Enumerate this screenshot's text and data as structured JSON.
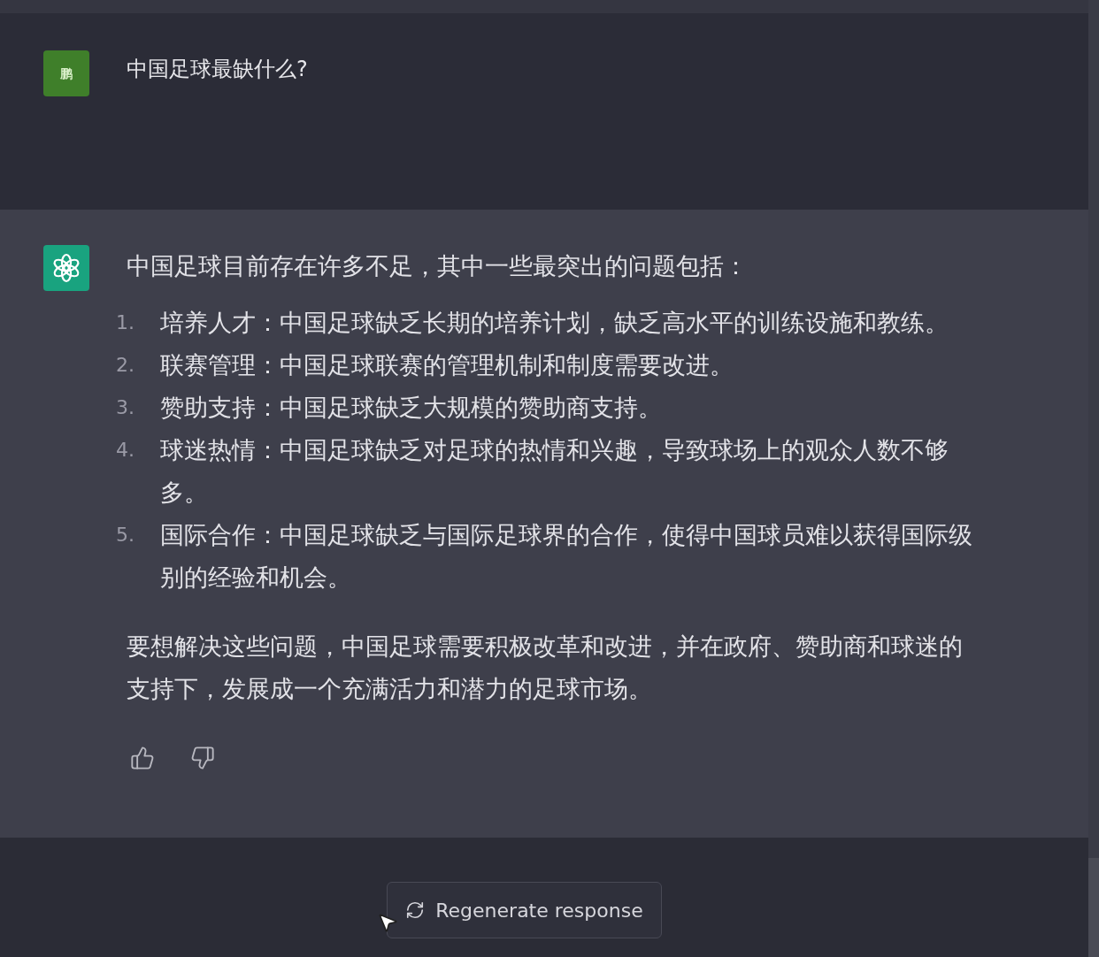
{
  "user_message": {
    "avatar": "鹏",
    "text": "中国足球最缺什么?"
  },
  "assistant_message": {
    "intro": "中国足球目前存在许多不足，其中一些最突出的问题包括：",
    "items": [
      {
        "number": "1.",
        "text": "培养人才：中国足球缺乏长期的培养计划，缺乏高水平的训练设施和教练。"
      },
      {
        "number": "2.",
        "text": "联赛管理：中国足球联赛的管理机制和制度需要改进。"
      },
      {
        "number": "3.",
        "text": "赞助支持：中国足球缺乏大规模的赞助商支持。"
      },
      {
        "number": "4.",
        "text": "球迷热情：中国足球缺乏对足球的热情和兴趣，导致球场上的观众人数不够多。"
      },
      {
        "number": "5.",
        "text": "国际合作：中国足球缺乏与国际足球界的合作，使得中国球员难以获得国际级别的经验和机会。"
      }
    ],
    "conclusion": "要想解决这些问题，中国足球需要积极改革和改进，并在政府、赞助商和球迷的支持下，发展成一个充满活力和潜力的足球市场。"
  },
  "regenerate_button": "Regenerate response"
}
